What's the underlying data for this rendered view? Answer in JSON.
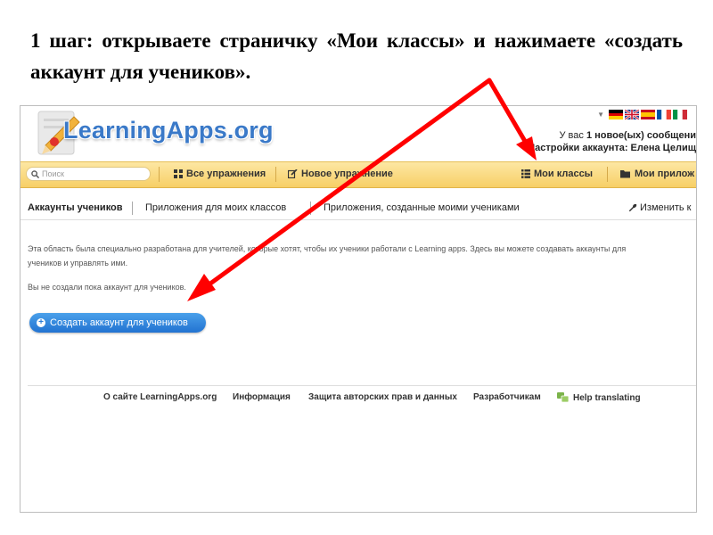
{
  "instruction": "1 шаг: открываете страничку «Мои классы» и нажимаете «создать аккаунт для учеников».",
  "header": {
    "logo": "LearningApps.org",
    "account_line1_prefix": "У вас ",
    "account_line1_bold": "1",
    "account_line1_suffix": " новое(ых) сообщени",
    "account_line2": "Настройки аккаунта: Елена Целищ",
    "flags": [
      "de",
      "gb",
      "es",
      "fr",
      "it"
    ]
  },
  "navbar": {
    "search_placeholder": "Поиск",
    "all_exercises": "Все упражнения",
    "new_exercise": "Новое упражнение",
    "my_classes": "Мои классы",
    "my_apps": "Мои прилож"
  },
  "tabs": {
    "student_accounts": "Аккаунты учеников",
    "class_apps": "Приложения для моих классов",
    "student_created_apps": "Приложения, созданные моими учениками",
    "edit": "Изменить к"
  },
  "content": {
    "description_line1": "Эта область была специально разработана для учителей, которые хотят, чтобы их ученики работали с Learning apps. Здесь вы можете создавать аккаунты для",
    "description_line2": "учеников и управлять ими.",
    "no_accounts": "Вы не создали пока аккаунт для учеников.",
    "create_button": "Создать аккаунт для учеников"
  },
  "footer": {
    "about": "О сайте LearningApps.org",
    "info": "Информация",
    "copyright": "Защита авторских прав и данных",
    "developers": "Разработчикам",
    "help_translating": "Help translating"
  },
  "colors": {
    "annotation_arrow": "#ff0000",
    "logo_blue": "#3a79c8",
    "nav_bar": "#f7cf66",
    "button_blue": "#2a7bd6"
  }
}
